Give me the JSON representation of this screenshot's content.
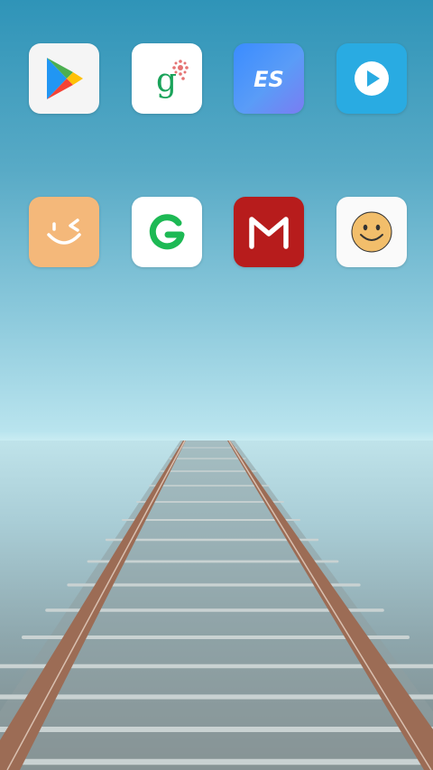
{
  "home_screen": {
    "apps": [
      {
        "icon": "google-play-icon",
        "background": "#f5f5f5"
      },
      {
        "icon": "google-pinyin-input-icon",
        "background": "#ffffff"
      },
      {
        "icon": "es-file-explorer-icon",
        "background": "#4f8ff7",
        "text": "ES"
      },
      {
        "icon": "video-player-icon",
        "background": "#29abe2"
      },
      {
        "icon": "wink-face-app-icon",
        "background": "#f4b87a"
      },
      {
        "icon": "green-g-app-icon",
        "background": "#ffffff"
      },
      {
        "icon": "gmail-m-icon",
        "background": "#b71c1c"
      },
      {
        "icon": "smiley-face-app-icon",
        "background": "#fafafa"
      }
    ]
  }
}
